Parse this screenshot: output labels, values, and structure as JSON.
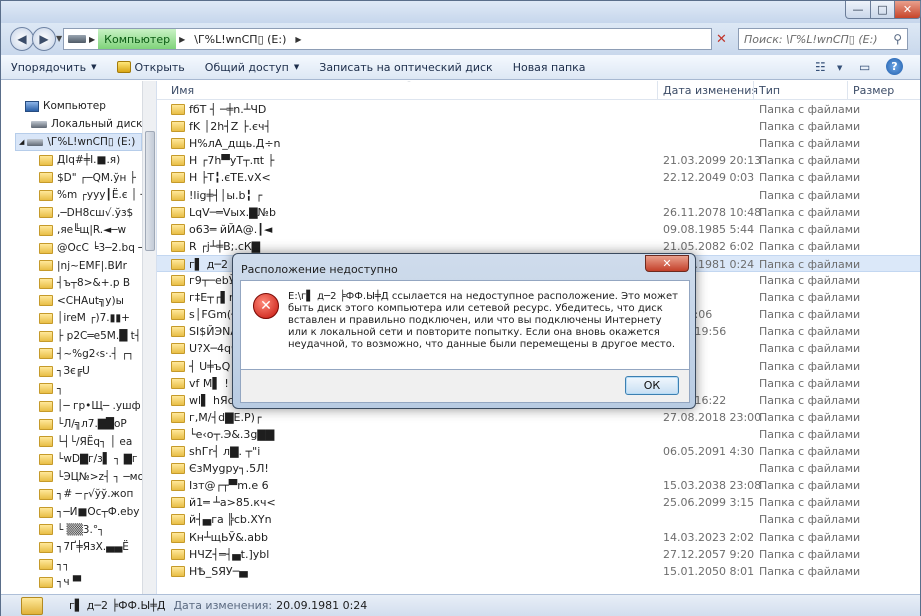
{
  "titlebar": {
    "minimize": "—",
    "maximize": "□",
    "close": "✕"
  },
  "address": {
    "crumbs": [
      "Компьютер",
      "\\Г%L!wnСП▯ (E:)"
    ],
    "search_placeholder": "Поиск: \\Г%L!wnСП▯ (E:)"
  },
  "toolbar": {
    "organize": "Упорядочить",
    "open": "Открыть",
    "share": "Общий доступ",
    "burn": "Записать на оптический диск",
    "new_folder": "Новая папка",
    "help": "?"
  },
  "columns": {
    "name": "Имя",
    "date": "Дата изменения",
    "type": "Тип",
    "size": "Размер"
  },
  "nav_tree": {
    "computer": "Компьютер",
    "local_disk": "Локальный диск (C:)",
    "drive_e": "\\Г%L!wnСП▯ (E:)",
    "folders": [
      "ДIq#╪Ⅰ.■.я)",
      "$D\" ┌─QM.ўн ├",
      "%m ┌ууу┃Ё.є │ ┤",
      ",─DH8сш√.ўз$",
      ",яе╚щ|R.◄─w",
      "@ОсС ╘3─2.bq ─",
      "|nj~EMF|.ВИr",
      "┤ъ┬8>&+.р В",
      "<CHAut╗у)ы",
      "│ireM ┌)7.▮▮+",
      "├ р2C═e5M.█ t┤",
      "┤~%g2‹ѕ·.┤ ┌┐",
      "┐Зє╔U",
      "┐",
      "│─ гр•Щ─ .ушф",
      "└Л/╗л7.▇█оР",
      "└┤└/ЯЁq┐ │ еа",
      "└wD▇г/з▌ ┐ ▇г",
      "└ЭЦ№>z┤ ┐ ─мо",
      "┐# ─┌√ўў.жоп",
      "┐─И■Ос┬Ф.eby",
      "└ ▒▒3.°┐",
      "┐7Ґ╪ЯзХ.▄▄Ё",
      "┐┐",
      "┐ч ▀"
    ]
  },
  "files": [
    {
      "name": "fбТ ┤ ─╪n.┴ЧD",
      "date": "",
      "type": "Папка с файлами"
    },
    {
      "name": "fK │2h┤Z ├.єч┤",
      "date": "",
      "type": "Папка с файлами"
    },
    {
      "name": "H%лА_дщь.Д÷n",
      "date": "",
      "type": "Папка с файлами"
    },
    {
      "name": "H ┌7h▀уТ┬.πt ├",
      "date": "21.03.2099 20:13",
      "type": "Папка с файлами"
    },
    {
      "name": "H ├T╏.єТЕ.vX<",
      "date": "22.12.2049 0:03",
      "type": "Папка с файлами"
    },
    {
      "name": "!lig╪┤│ы.b╏ ┌",
      "date": "",
      "type": "Папка с файлами"
    },
    {
      "name": "LqV─═Vых.▇№b",
      "date": "26.11.2078 10:48",
      "type": "Папка с файлами"
    },
    {
      "name": "о63═ йЙА@.┃◄",
      "date": "09.08.1985 5:44",
      "type": "Папка с файлами"
    },
    {
      "name": "R ┌j┴╪В;.cК▇",
      "date": "21.05.2082 6:02",
      "type": "Папка с файлами"
    },
    {
      "name": "г▌ д─2 ╞ФФ.Ы╪Д",
      "date": "20.09.1981 0:24",
      "type": "Папка с файлами"
    },
    {
      "name": "г9┬─ebЎhg.┤┌",
      "date": "",
      "type": "Папка с файлами"
    },
    {
      "name": "г‡Е┬┌▌m.▇┌┐",
      "date": "",
      "type": "Папка с файлами"
    },
    {
      "name": "s│FGm(┤",
      "date": "043 2:06",
      "type": "Папка с файлами"
    },
    {
      "name": "SI$ЙЭNAЦ",
      "date": "2007 19:56",
      "type": "Папка с файлами"
    },
    {
      "name": "U?X─4qч",
      "date": "",
      "type": "Папка с файлами"
    },
    {
      "name": "┤ U╪ъQ",
      "date": "",
      "type": "Папка с файлами"
    },
    {
      "name": "vf M▌ !",
      "date": "",
      "type": "Папка с файлами"
    },
    {
      "name": "wl▌ hЯc┤",
      "date": "2059 16:22",
      "type": "Папка с файлами"
    },
    {
      "name": "г,М/┤d▇Е.Р)┌",
      "date": "27.08.2018 23:00",
      "type": "Папка с файлами"
    },
    {
      "name": "└е‹о┬.Э&.3g▇▇",
      "date": "",
      "type": "Папка с файлами"
    },
    {
      "name": "ѕhГr┤ л▇. ┬\"i",
      "date": "06.05.2091 4:30",
      "type": "Папка с файлами"
    },
    {
      "name": "ЄзМygpу┐.5Л!",
      "date": "",
      "type": "Папка с файлами"
    },
    {
      "name": "Iзт@┌┬▀m.е 6",
      "date": "15.03.2038 23:08",
      "type": "Папка с файлами"
    },
    {
      "name": "й1═ ┴а>85.кч<",
      "date": "25.06.2099 3:15",
      "type": "Папка с файлами"
    },
    {
      "name": "й┤▄гa ╠cb.XYn",
      "date": "",
      "type": "Папка с файлами"
    },
    {
      "name": "Кн┴щЬЎ&.abb",
      "date": "14.03.2023 2:02",
      "type": "Папка с файлами"
    },
    {
      "name": "НЧZ┤═┤▄t.]ybl",
      "date": "27.12.2057 9:20",
      "type": "Папка с файлами"
    },
    {
      "name": "НѢ_ЅЯУ─▄",
      "date": "15.01.2050 8:01",
      "type": "Папка с файлами"
    }
  ],
  "statusbar": {
    "name": "г▌ д─2 ╞ФФ.Ы╪Д",
    "date_label": "Дата изменения:",
    "date_value": "20.09.1981 0:24"
  },
  "dialog": {
    "title": "Расположение недоступно",
    "close": "✕",
    "message": "E:\\г▌ д─2 ╞ФФ.Ы╪Д ссылается на недоступное расположение. Это может быть диск этого компьютера или сетевой ресурс. Убедитесь, что диск вставлен и правильно подключен, или что вы подключены Интернету или к локальной сети и повторите попытку. Если она вновь окажется неудачной, то возможно, что данные были перемещены в другое место.",
    "ok": "ОК"
  }
}
